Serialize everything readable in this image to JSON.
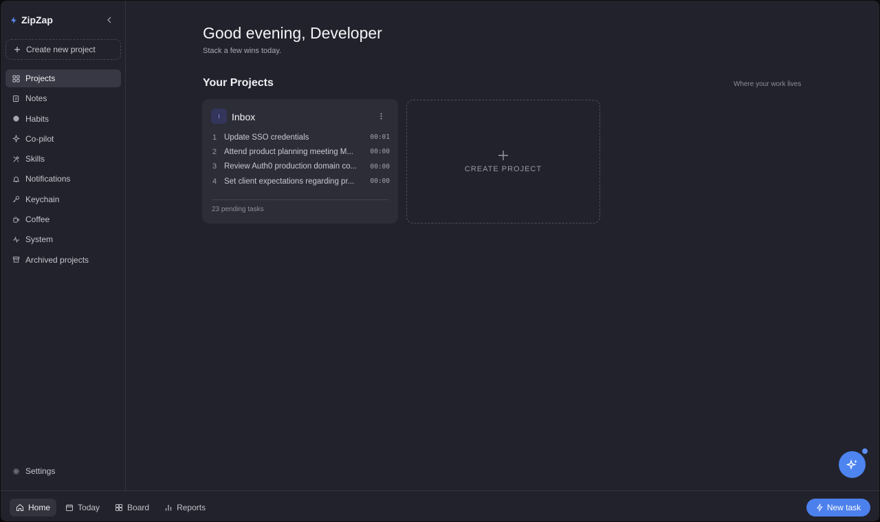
{
  "app": {
    "name": "ZipZap"
  },
  "sidebar": {
    "create_label": "Create new project",
    "items": [
      {
        "label": "Projects",
        "icon": "grid-icon"
      },
      {
        "label": "Notes",
        "icon": "note-icon"
      },
      {
        "label": "Habits",
        "icon": "circle-icon"
      },
      {
        "label": "Co-pilot",
        "icon": "sparkle-icon"
      },
      {
        "label": "Skills",
        "icon": "tools-icon"
      },
      {
        "label": "Notifications",
        "icon": "bell-icon"
      },
      {
        "label": "Keychain",
        "icon": "key-icon"
      },
      {
        "label": "Coffee",
        "icon": "coffee-icon"
      },
      {
        "label": "System",
        "icon": "activity-icon"
      },
      {
        "label": "Archived projects",
        "icon": "archive-icon"
      }
    ],
    "settings_label": "Settings"
  },
  "main": {
    "greeting": "Good evening, Developer",
    "subtitle": "Stack a few wins today.",
    "section_title": "Your Projects",
    "section_hint": "Where your work lives",
    "project": {
      "badge": "I",
      "title": "Inbox",
      "tasks": [
        {
          "num": "1",
          "title": "Update SSO credentials",
          "time": "00:01"
        },
        {
          "num": "2",
          "title": "Attend product planning meeting M...",
          "time": "00:00"
        },
        {
          "num": "3",
          "title": "Review Auth0 production domain co...",
          "time": "00:00"
        },
        {
          "num": "4",
          "title": "Set client expectations regarding pr...",
          "time": "00:00"
        }
      ],
      "footer": "23 pending tasks"
    },
    "create_card_label": "CREATE PROJECT"
  },
  "bottombar": {
    "tabs": [
      {
        "label": "Home",
        "icon": "home-icon"
      },
      {
        "label": "Today",
        "icon": "calendar-icon"
      },
      {
        "label": "Board",
        "icon": "board-icon"
      },
      {
        "label": "Reports",
        "icon": "bar-chart-icon"
      }
    ],
    "new_task_label": "New task"
  },
  "colors": {
    "accent": "#4c80ec",
    "background": "#22222c",
    "card": "#2d2d38"
  }
}
